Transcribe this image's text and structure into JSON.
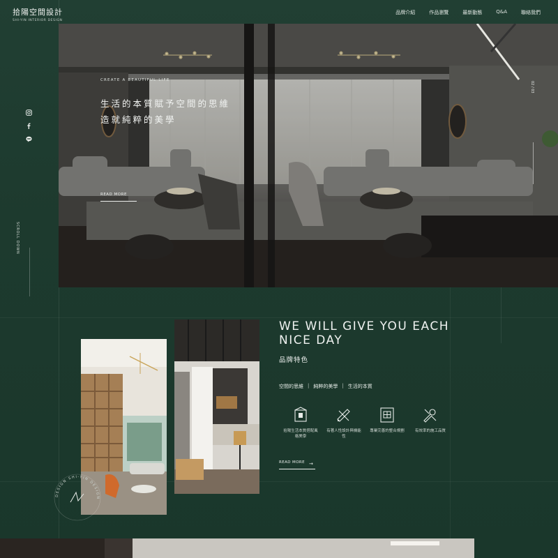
{
  "header": {
    "logo": "拾陽空間設計",
    "logo_sub": "SHI-YIN INTERIOR DESIGN",
    "nav": [
      "品牌介紹",
      "作品瀏覽",
      "最新動態",
      "Q&A",
      "聯絡我們"
    ]
  },
  "side": {
    "icons": [
      "instagram-icon",
      "facebook-icon",
      "line-icon"
    ],
    "scroll_label": "SCROLL DOWN"
  },
  "hero": {
    "eyebrow": "CREATE A BEAUTIFUL LIFE",
    "line1": "生活的本質賦予空間的思維",
    "line2": "造就純粹的美學",
    "more": "READ MORE",
    "pager": "02 / 03"
  },
  "section": {
    "title_line1": "WE WILL GIVE YOU EACH",
    "title_line2": "NICE DAY",
    "subtitle": "品牌特色",
    "tags": [
      "空間的思維",
      "純粹的美學",
      "生活的本質"
    ],
    "features": [
      {
        "icon": "house-icon",
        "text": "拾陽生活本質搭配風格美學"
      },
      {
        "icon": "pencil-ruler-icon",
        "text": "有著人性設計與機能性"
      },
      {
        "icon": "blueprint-icon",
        "text": "專業完善的整合規劃"
      },
      {
        "icon": "tools-icon",
        "text": "有效率的施工品質"
      }
    ],
    "more": "READ MORE"
  },
  "badge": {
    "text": "DESIGN SHI-YIN DESIGN"
  },
  "colors": {
    "background": "#1d3a2e",
    "text": "#e8ece9"
  }
}
